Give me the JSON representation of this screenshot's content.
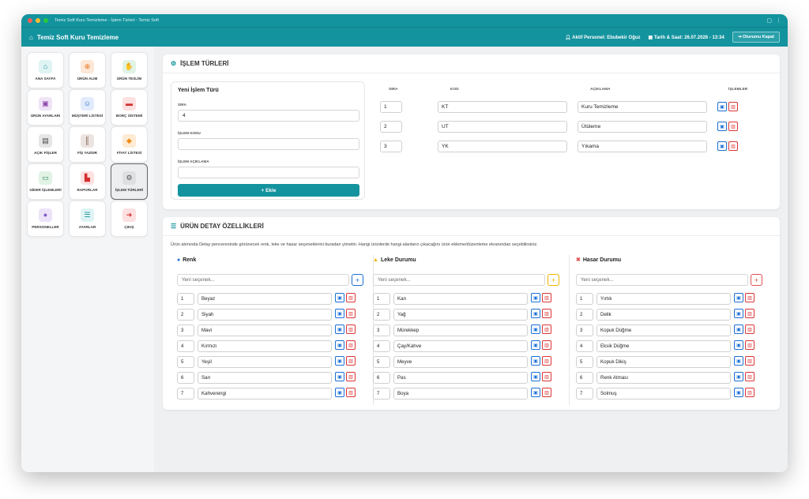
{
  "window": {
    "title": "Temiz Soft Kuru Temizleme - İşlem Türleri - Temiz Soft"
  },
  "appbar": {
    "brand": "Temiz Soft Kuru Temizleme",
    "personnel_label": "Aktif Personel:",
    "personnel_name": "Ebubekir Oğuz",
    "datetime_label": "Tarih & Saat:",
    "datetime": "26.07.2026 - 13:34",
    "logout": "Oturumu Kapat"
  },
  "colors": {
    "teal": "#13939e",
    "save": "#1a6fd6",
    "delete": "#dd3333",
    "leke": "#f0b400"
  },
  "sidebar": {
    "items": [
      {
        "label": "ANA SAYFA",
        "icon": "home-icon",
        "glyph": "⌂",
        "bg": "#dff3f3",
        "fg": "#13939e"
      },
      {
        "label": "ÜRÜN ALIM",
        "icon": "plus-circle-icon",
        "glyph": "⊕",
        "bg": "#fde7d6",
        "fg": "#e8711c"
      },
      {
        "label": "ÜRÜN TESLİM",
        "icon": "hand-icon",
        "glyph": "✋",
        "bg": "#e1f3e5",
        "fg": "#2e8b57"
      },
      {
        "label": "ÜRÜN AYARLARI",
        "icon": "box-icon",
        "glyph": "▣",
        "bg": "#efe3f6",
        "fg": "#8e44ad"
      },
      {
        "label": "MÜŞTERİ LİSTESİ",
        "icon": "users-icon",
        "glyph": "☺",
        "bg": "#e1ebfb",
        "fg": "#2f6fd1"
      },
      {
        "label": "BORÇ SİSTEMİ",
        "icon": "wallet-icon",
        "glyph": "▬",
        "bg": "#fde0e0",
        "fg": "#d32f2f"
      },
      {
        "label": "AÇIK FİŞLER",
        "icon": "file-icon",
        "glyph": "▤",
        "bg": "#e6e6e6",
        "fg": "#444"
      },
      {
        "label": "FİŞ YAZDIR",
        "icon": "barcode-icon",
        "glyph": "║",
        "bg": "#ece4e0",
        "fg": "#7a5545"
      },
      {
        "label": "FİYAT LİSTESİ",
        "icon": "tag-icon",
        "glyph": "◆",
        "bg": "#fdebd3",
        "fg": "#f08c1c"
      },
      {
        "label": "GİDER İŞLEMLERİ",
        "icon": "cash-icon",
        "glyph": "▭",
        "bg": "#e1f3e5",
        "fg": "#2e8b57"
      },
      {
        "label": "RAPORLAR",
        "icon": "chart-icon",
        "glyph": "▙",
        "bg": "#fde0e0",
        "fg": "#d32f2f"
      },
      {
        "label": "İŞLEM TÜRLERİ",
        "icon": "gears-icon",
        "glyph": "⚙",
        "bg": "#dedfe0",
        "fg": "#555"
      },
      {
        "label": "PERSONELLER",
        "icon": "user-icon",
        "glyph": "●",
        "bg": "#ece3f8",
        "fg": "#7e57c2"
      },
      {
        "label": "AYARLAR",
        "icon": "sliders-icon",
        "glyph": "☰",
        "bg": "#dff3f3",
        "fg": "#13939e"
      },
      {
        "label": "ÇIKIŞ",
        "icon": "logout-icon",
        "glyph": "➜",
        "bg": "#fde0e0",
        "fg": "#d32f2f"
      }
    ]
  },
  "islem": {
    "title": "İŞLEM TÜRLERİ",
    "form": {
      "title": "Yeni İşlem Türü",
      "sira_label": "SIRA",
      "sira_value": "4",
      "kod_label": "İŞLEM KODU",
      "kod_value": "",
      "aciklama_label": "İŞLEM AÇIKLAMA",
      "aciklama_value": "",
      "add_label": "+ Ekle"
    },
    "table": {
      "headers": [
        "SIRA",
        "KOD",
        "AÇIKLAMA",
        "İŞLEMLER"
      ],
      "rows": [
        {
          "sira": "1",
          "kod": "KT",
          "aciklama": "Kuru Temizleme"
        },
        {
          "sira": "2",
          "kod": "UT",
          "aciklama": "Ütüleme"
        },
        {
          "sira": "3",
          "kod": "YK",
          "aciklama": "Yıkama"
        }
      ]
    }
  },
  "detay": {
    "title": "ÜRÜN DETAY ÖZELLİKLERİ",
    "description": "Ürün alımında Detay penceresinde görünecek renk, leke ve hasar seçeneklerini buradan yönetin. Hangi ürünlerde hangi alanların çıkacağını ürün ekleme/düzenleme ekranından seçebilirsiniz.",
    "placeholder": "Yeni seçenek...",
    "columns": [
      {
        "title": "Renk",
        "icon": "palette-icon",
        "glyph": "●",
        "color": "#1a6fd6",
        "items": [
          "Beyaz",
          "Siyah",
          "Mavi",
          "Kırmızı",
          "Yeşil",
          "Sarı",
          "Kahverengi"
        ]
      },
      {
        "title": "Leke Durumu",
        "icon": "warning-icon",
        "glyph": "▲",
        "color": "#f0b400",
        "items": [
          "Kan",
          "Yağ",
          "Mürekkep",
          "Çay/Kahve",
          "Meyve",
          "Pas",
          "Boya"
        ]
      },
      {
        "title": "Hasar Durumu",
        "icon": "damage-icon",
        "glyph": "✖",
        "color": "#e05050",
        "items": [
          "Yırtık",
          "Delik",
          "Kopuk Düğme",
          "Eksik Düğme",
          "Kopuk Dikiş",
          "Renk Atması",
          "Solmuş"
        ]
      }
    ]
  }
}
